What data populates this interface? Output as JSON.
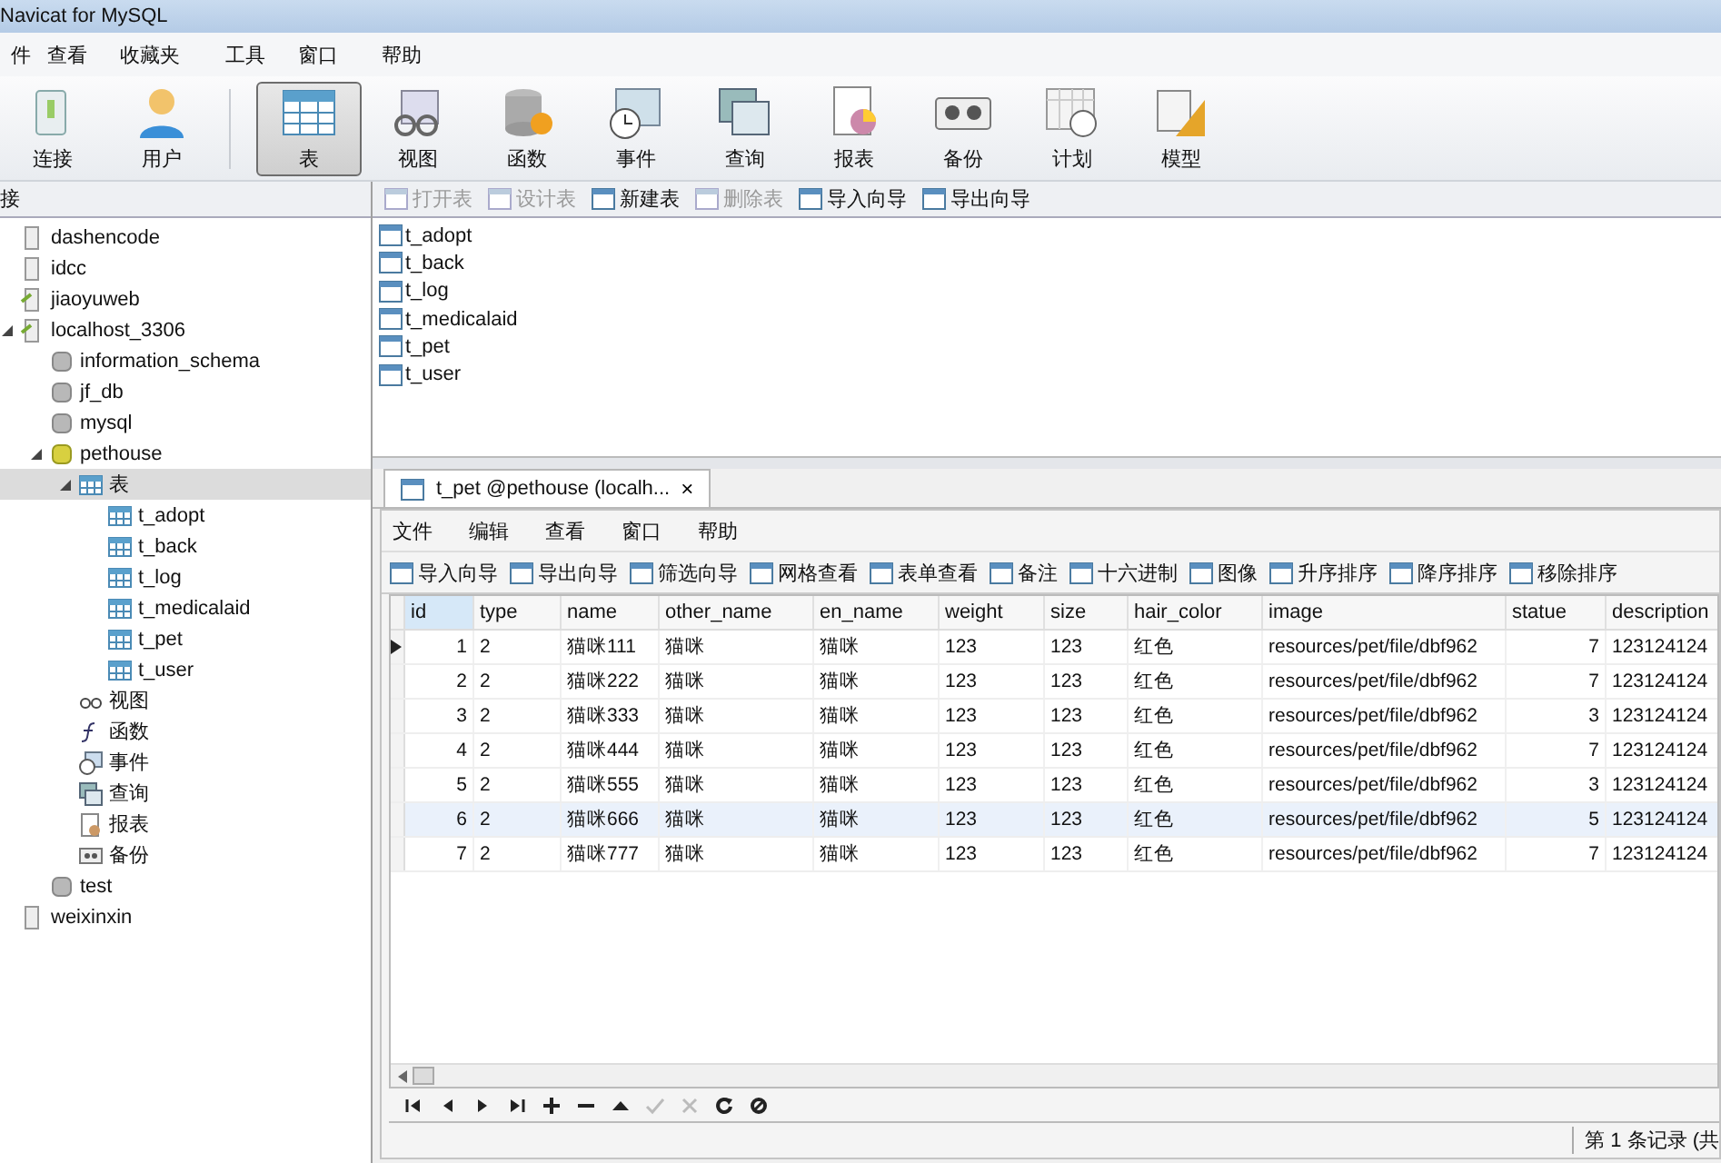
{
  "window": {
    "title": "Navicat for MySQL"
  },
  "menu": [
    "件",
    "查看",
    "收藏夹",
    "工具",
    "窗口",
    "帮助"
  ],
  "toolbar": [
    {
      "kind": "connection",
      "label": "连接",
      "selected": false
    },
    {
      "kind": "user",
      "label": "用户",
      "selected": false
    },
    {
      "kind": "table",
      "label": "表",
      "selected": true
    },
    {
      "kind": "view",
      "label": "视图",
      "selected": false
    },
    {
      "kind": "function",
      "label": "函数",
      "selected": false
    },
    {
      "kind": "event",
      "label": "事件",
      "selected": false
    },
    {
      "kind": "query",
      "label": "查询",
      "selected": false
    },
    {
      "kind": "report",
      "label": "报表",
      "selected": false
    },
    {
      "kind": "backup",
      "label": "备份",
      "selected": false
    },
    {
      "kind": "schedule",
      "label": "计划",
      "selected": false
    },
    {
      "kind": "model",
      "label": "模型",
      "selected": false
    }
  ],
  "sidebar": {
    "title": "接",
    "items": [
      {
        "kind": "server",
        "label": "dashencode",
        "selected": false
      },
      {
        "kind": "server",
        "label": "idcc",
        "selected": false
      },
      {
        "kind": "connected",
        "label": "jiaoyuweb",
        "selected": false
      },
      {
        "kind": "connected",
        "label": "localhost_3306",
        "selected": false,
        "expanded": true,
        "children": [
          {
            "kind": "database",
            "label": "information_schema",
            "selected": false
          },
          {
            "kind": "database",
            "label": "jf_db",
            "selected": false
          },
          {
            "kind": "database",
            "label": "mysql",
            "selected": false
          },
          {
            "kind": "open-database",
            "label": "pethouse",
            "selected": false,
            "expanded": true,
            "children": [
              {
                "kind": "table",
                "label": "表",
                "selected": true,
                "expanded": true,
                "children": [
                  {
                    "kind": "table",
                    "label": "t_adopt",
                    "selected": false
                  },
                  {
                    "kind": "table",
                    "label": "t_back",
                    "selected": false
                  },
                  {
                    "kind": "table",
                    "label": "t_log",
                    "selected": false
                  },
                  {
                    "kind": "table",
                    "label": "t_medicalaid",
                    "selected": false
                  },
                  {
                    "kind": "table",
                    "label": "t_pet",
                    "selected": false
                  },
                  {
                    "kind": "table",
                    "label": "t_user",
                    "selected": false
                  }
                ]
              },
              {
                "kind": "view",
                "label": "视图",
                "selected": false
              },
              {
                "kind": "function",
                "label": "函数",
                "selected": false
              },
              {
                "kind": "event",
                "label": "事件",
                "selected": false
              },
              {
                "kind": "query",
                "label": "查询",
                "selected": false
              },
              {
                "kind": "report",
                "label": "报表",
                "selected": false
              },
              {
                "kind": "backup",
                "label": "备份",
                "selected": false
              }
            ]
          },
          {
            "kind": "database",
            "label": "test",
            "selected": false
          }
        ]
      },
      {
        "kind": "server",
        "label": "weixinxin",
        "selected": false
      }
    ]
  },
  "object_toolbar": [
    {
      "label": "打开表",
      "disabled": true
    },
    {
      "label": "设计表",
      "disabled": true
    },
    {
      "label": "新建表",
      "disabled": false
    },
    {
      "label": "删除表",
      "disabled": true
    },
    {
      "label": "导入向导",
      "disabled": false
    },
    {
      "label": "导出向导",
      "disabled": false
    }
  ],
  "objects": [
    "t_adopt",
    "t_back",
    "t_log",
    "t_medicalaid",
    "t_pet",
    "t_user"
  ],
  "tab": {
    "label": "t_pet @pethouse (localh...",
    "close": "×"
  },
  "inner_menu": [
    "文件",
    "编辑",
    "查看",
    "窗口",
    "帮助"
  ],
  "inner_toolbar": [
    "导入向导",
    "导出向导",
    "筛选向导",
    "网格查看",
    "表单查看",
    "备注",
    "十六进制",
    "图像",
    "升序排序",
    "降序排序",
    "移除排序"
  ],
  "table": {
    "columns": [
      "id",
      "type",
      "name",
      "other_name",
      "en_name",
      "weight",
      "size",
      "hair_color",
      "image",
      "statue",
      "description"
    ],
    "rows": [
      {
        "current": true,
        "selected": false,
        "cells": [
          "1",
          "2",
          "猫咪111",
          "猫咪",
          "猫咪",
          "123",
          "123",
          "红色",
          "resources/pet/file/dbf962",
          "7",
          "123124124"
        ]
      },
      {
        "current": false,
        "selected": false,
        "cells": [
          "2",
          "2",
          "猫咪222",
          "猫咪",
          "猫咪",
          "123",
          "123",
          "红色",
          "resources/pet/file/dbf962",
          "7",
          "123124124"
        ]
      },
      {
        "current": false,
        "selected": false,
        "cells": [
          "3",
          "2",
          "猫咪333",
          "猫咪",
          "猫咪",
          "123",
          "123",
          "红色",
          "resources/pet/file/dbf962",
          "3",
          "123124124"
        ]
      },
      {
        "current": false,
        "selected": false,
        "cells": [
          "4",
          "2",
          "猫咪444",
          "猫咪",
          "猫咪",
          "123",
          "123",
          "红色",
          "resources/pet/file/dbf962",
          "7",
          "123124124"
        ]
      },
      {
        "current": false,
        "selected": false,
        "cells": [
          "5",
          "2",
          "猫咪555",
          "猫咪",
          "猫咪",
          "123",
          "123",
          "红色",
          "resources/pet/file/dbf962",
          "3",
          "123124124"
        ]
      },
      {
        "current": false,
        "selected": true,
        "cells": [
          "6",
          "2",
          "猫咪666",
          "猫咪",
          "猫咪",
          "123",
          "123",
          "红色",
          "resources/pet/file/dbf962",
          "5",
          "123124124"
        ]
      },
      {
        "current": false,
        "selected": false,
        "cells": [
          "7",
          "2",
          "猫咪777",
          "猫咪",
          "猫咪",
          "123",
          "123",
          "红色",
          "resources/pet/file/dbf962",
          "7",
          "123124124"
        ]
      }
    ]
  },
  "navigator": [
    {
      "kind": "first",
      "disabled": false
    },
    {
      "kind": "prev",
      "disabled": false
    },
    {
      "kind": "next",
      "disabled": false
    },
    {
      "kind": "last",
      "disabled": false
    },
    {
      "kind": "add",
      "disabled": false
    },
    {
      "kind": "delete",
      "disabled": false
    },
    {
      "kind": "up",
      "disabled": false
    },
    {
      "kind": "apply",
      "disabled": true
    },
    {
      "kind": "cancel",
      "disabled": true
    },
    {
      "kind": "refresh",
      "disabled": false
    },
    {
      "kind": "stop",
      "disabled": false
    }
  ],
  "status_bar": "第 1 条记录 (共"
}
